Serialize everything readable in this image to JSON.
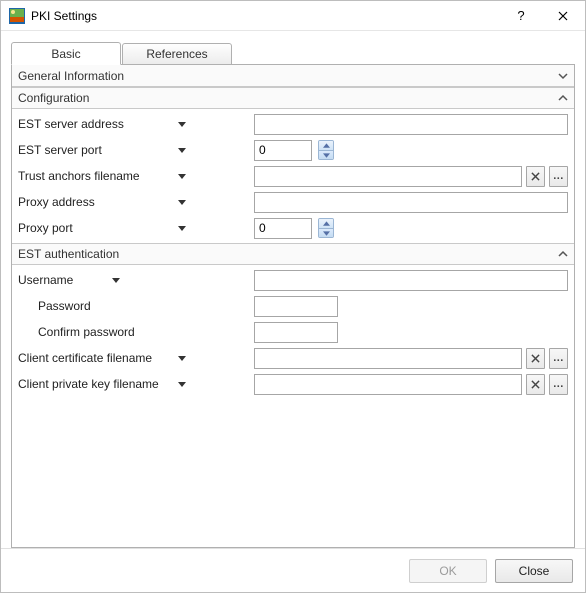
{
  "window": {
    "title": "PKI Settings"
  },
  "tabs": [
    {
      "label": "Basic",
      "active": true
    },
    {
      "label": "References",
      "active": false
    }
  ],
  "sections": {
    "general_info": {
      "title": "General Information",
      "expanded": false
    },
    "configuration": {
      "title": "Configuration",
      "expanded": true,
      "fields": {
        "est_server_address": {
          "label": "EST server address",
          "value": ""
        },
        "est_server_port": {
          "label": "EST server port",
          "value": "0"
        },
        "trust_anchors_filename": {
          "label": "Trust anchors filename",
          "value": ""
        },
        "proxy_address": {
          "label": "Proxy address",
          "value": ""
        },
        "proxy_port": {
          "label": "Proxy port",
          "value": "0"
        }
      }
    },
    "est_auth": {
      "title": "EST authentication",
      "expanded": true,
      "fields": {
        "username": {
          "label": "Username",
          "value": ""
        },
        "password": {
          "label": "Password",
          "value": ""
        },
        "confirm_password": {
          "label": "Confirm password",
          "value": ""
        },
        "client_cert_filename": {
          "label": "Client certificate filename",
          "value": ""
        },
        "client_privkey_filename": {
          "label": "Client private key filename",
          "value": ""
        }
      }
    }
  },
  "footer": {
    "ok_label": "OK",
    "close_label": "Close"
  },
  "buttons": {
    "browse_label": "..."
  }
}
